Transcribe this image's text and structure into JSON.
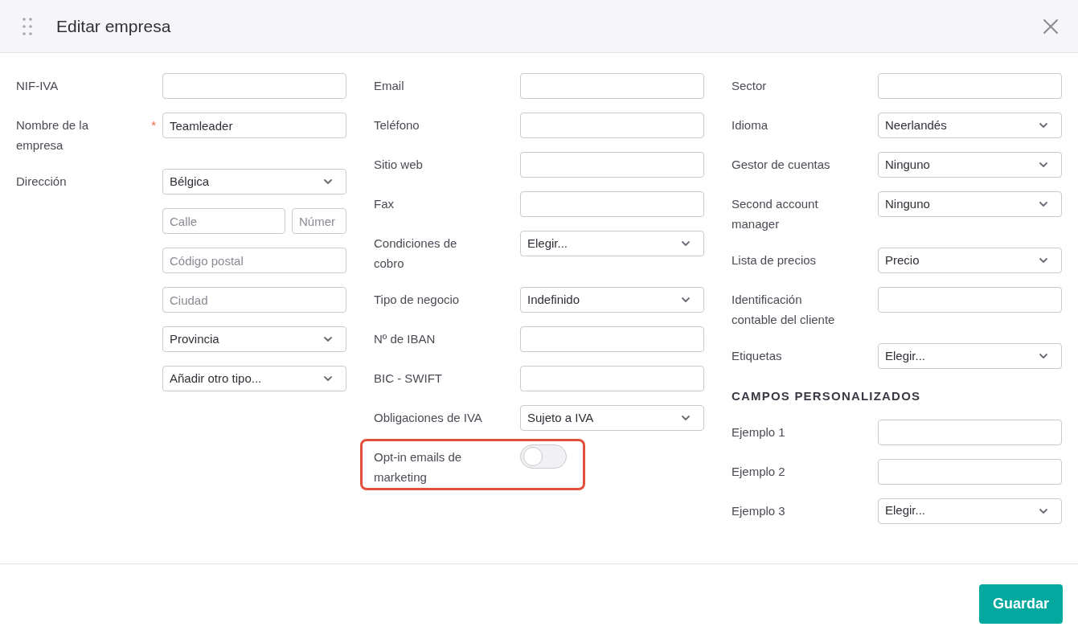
{
  "dialog": {
    "title": "Editar empresa"
  },
  "columns": [
    {
      "rows": [
        {
          "kind": "field",
          "label": "NIF-IVA",
          "controls": [
            {
              "kind": "text"
            }
          ]
        },
        {
          "kind": "field",
          "label": "Nombre de la empresa",
          "required_mark": "*",
          "controls": [
            {
              "kind": "text",
              "value": "Teamleader"
            }
          ]
        },
        {
          "kind": "field",
          "label": "Dirección",
          "controls": [
            {
              "kind": "select",
              "value": "Bélgica"
            },
            {
              "kind": "pair",
              "items": [
                {
                  "kind": "text",
                  "placeholder": "Calle"
                },
                {
                  "kind": "text",
                  "placeholder": "Númer"
                }
              ]
            },
            {
              "kind": "text",
              "placeholder": "Código postal"
            },
            {
              "kind": "text",
              "placeholder": "Ciudad"
            },
            {
              "kind": "select",
              "value": "Provincia"
            },
            {
              "kind": "select",
              "value": "Añadir otro tipo..."
            }
          ]
        }
      ]
    },
    {
      "rows": [
        {
          "kind": "field",
          "label": "Email",
          "controls": [
            {
              "kind": "text"
            }
          ]
        },
        {
          "kind": "field",
          "label": "Teléfono",
          "controls": [
            {
              "kind": "text"
            }
          ]
        },
        {
          "kind": "field",
          "label": "Sitio web",
          "controls": [
            {
              "kind": "text"
            }
          ]
        },
        {
          "kind": "field",
          "label": "Fax",
          "controls": [
            {
              "kind": "text"
            }
          ]
        },
        {
          "kind": "field",
          "label": "Condiciones de cobro",
          "controls": [
            {
              "kind": "select",
              "value": "Elegir..."
            }
          ]
        },
        {
          "kind": "field",
          "label": "Tipo de negocio",
          "controls": [
            {
              "kind": "select",
              "value": "Indefinido"
            }
          ]
        },
        {
          "kind": "field",
          "label": "Nº de IBAN",
          "controls": [
            {
              "kind": "text"
            }
          ]
        },
        {
          "kind": "field",
          "label": "BIC - SWIFT",
          "controls": [
            {
              "kind": "text"
            }
          ]
        },
        {
          "kind": "field",
          "label": "Obligaciones de IVA",
          "controls": [
            {
              "kind": "select",
              "value": "Sujeto a IVA"
            }
          ]
        },
        {
          "kind": "field",
          "label": "Opt-in emails de marketing",
          "highlighted": true,
          "controls": [
            {
              "kind": "toggle",
              "on": false
            }
          ]
        }
      ]
    },
    {
      "rows": [
        {
          "kind": "field",
          "label": "Sector",
          "controls": [
            {
              "kind": "text"
            }
          ]
        },
        {
          "kind": "field",
          "label": "Idioma",
          "controls": [
            {
              "kind": "select",
              "value": "Neerlandés"
            }
          ]
        },
        {
          "kind": "field",
          "label": "Gestor de cuentas",
          "controls": [
            {
              "kind": "select",
              "value": "Ninguno"
            }
          ]
        },
        {
          "kind": "field",
          "label": "Second account manager",
          "controls": [
            {
              "kind": "select",
              "value": "Ninguno"
            }
          ]
        },
        {
          "kind": "field",
          "label": "Lista de precios",
          "controls": [
            {
              "kind": "select",
              "value": "Precio"
            }
          ]
        },
        {
          "kind": "field",
          "label": "Identificación contable del cliente",
          "controls": [
            {
              "kind": "text"
            }
          ]
        },
        {
          "kind": "field",
          "label": "Etiquetas",
          "controls": [
            {
              "kind": "select",
              "value": "Elegir..."
            }
          ]
        },
        {
          "kind": "heading",
          "label": "CAMPOS PERSONALIZADOS"
        },
        {
          "kind": "field",
          "label": "Ejemplo 1",
          "controls": [
            {
              "kind": "text"
            }
          ]
        },
        {
          "kind": "field",
          "label": "Ejemplo 2",
          "controls": [
            {
              "kind": "text"
            }
          ]
        },
        {
          "kind": "field",
          "label": "Ejemplo 3",
          "controls": [
            {
              "kind": "select",
              "value": "Elegir..."
            }
          ]
        }
      ]
    }
  ],
  "footer": {
    "save_button": "Guardar"
  }
}
